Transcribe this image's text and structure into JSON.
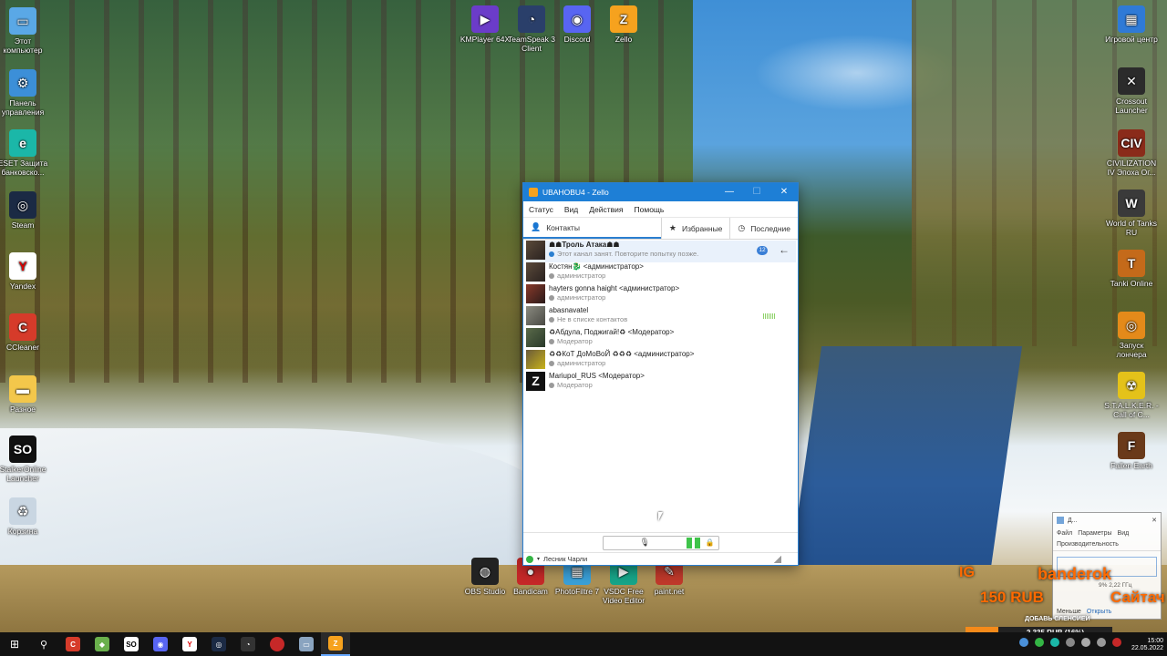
{
  "desktop_icons_left": [
    {
      "label": "Этот компьютер",
      "icon": "monitor-icon",
      "color": "#5aa8e6",
      "glyph": "▭"
    },
    {
      "label": "Панель управления",
      "icon": "control-panel-icon",
      "color": "#3c8fd8",
      "glyph": "⚙"
    },
    {
      "label": "ESET Защита банковско...",
      "icon": "eset-icon",
      "color": "#1bb7a8",
      "glyph": "e"
    },
    {
      "label": "Steam",
      "icon": "steam-icon",
      "color": "#1b2a44",
      "glyph": "◎"
    },
    {
      "label": "Yandex",
      "icon": "yandex-icon",
      "color": "#ffffff",
      "glyph": "Y"
    },
    {
      "label": "CCleaner",
      "icon": "ccleaner-icon",
      "color": "#d63b2a",
      "glyph": "C"
    },
    {
      "label": "Разное",
      "icon": "folder-icon",
      "color": "#f3c74b",
      "glyph": "▬"
    },
    {
      "label": "StalkerOnline Launcher",
      "icon": "stalkeronline-icon",
      "color": "#111111",
      "glyph": "SO"
    },
    {
      "label": "Корзина",
      "icon": "recycle-bin-icon",
      "color": "#c9d6e2",
      "glyph": "♻"
    }
  ],
  "desktop_icons_top": [
    {
      "label": "KMPlayer 64X",
      "icon": "kmplayer-icon",
      "color": "#6b3cc9",
      "glyph": "▶"
    },
    {
      "label": "TeamSpeak 3 Client",
      "icon": "teamspeak-icon",
      "color": "#2a3f6a",
      "glyph": "◔"
    },
    {
      "label": "Discord",
      "icon": "discord-icon",
      "color": "#5865f2",
      "glyph": "◉"
    },
    {
      "label": "Zello",
      "icon": "zello-icon",
      "color": "#f6a21e",
      "glyph": "Z"
    }
  ],
  "desktop_icons_right": [
    {
      "label": "Игровой центр",
      "icon": "game-center-icon",
      "color": "#2f7ad6",
      "glyph": "▦"
    },
    {
      "label": "Crossout Launcher",
      "icon": "crossout-icon",
      "color": "#2b2b2b",
      "glyph": "✕"
    },
    {
      "label": "CIVILIZATION IV Эпоха Ог...",
      "icon": "civilization-icon",
      "color": "#8a2b1a",
      "glyph": "CIV"
    },
    {
      "label": "World of Tanks RU",
      "icon": "world-of-tanks-icon",
      "color": "#3a3a3a",
      "glyph": "W"
    },
    {
      "label": "Tanki Online",
      "icon": "tanki-online-icon",
      "color": "#c46a1a",
      "glyph": "T"
    },
    {
      "label": "Запуск лончера",
      "icon": "launcher-icon",
      "color": "#e48a1a",
      "glyph": "◎"
    },
    {
      "label": "S.T.A.L.K.E.R. - Call of C...",
      "icon": "stalker-icon",
      "color": "#e4c21a",
      "glyph": "☢"
    },
    {
      "label": "Fallen Earth",
      "icon": "fallen-earth-icon",
      "color": "#6a3a1a",
      "glyph": "F"
    }
  ],
  "desktop_icons_bottom": [
    {
      "label": "OBS Studio",
      "icon": "obs-icon",
      "color": "#222222",
      "glyph": "◍"
    },
    {
      "label": "Bandicam",
      "icon": "bandicam-icon",
      "color": "#c62828",
      "glyph": "●"
    },
    {
      "label": "PhotoFiltre 7",
      "icon": "photofiltre-icon",
      "color": "#3aa0d8",
      "glyph": "▦"
    },
    {
      "label": "VSDC Free Video Editor",
      "icon": "vsdc-icon",
      "color": "#17a589",
      "glyph": "▶"
    },
    {
      "label": "paint.net",
      "icon": "paintnet-icon",
      "color": "#c0392b",
      "glyph": "✎"
    }
  ],
  "zello": {
    "title": "UBAHOBU4 - Zello",
    "menu": [
      "Статус",
      "Вид",
      "Действия",
      "Помощь"
    ],
    "tabs": {
      "contacts": "Контакты",
      "favorites": "Избранные",
      "recent": "Последние"
    },
    "contacts": [
      {
        "name": "☗☗Троль Атака☗☗",
        "status": "Этот канал занят. Повторите попытку позже.",
        "badge": "12",
        "bold": true
      },
      {
        "name": "Костян🐉 <администратор>",
        "status": "администратор"
      },
      {
        "name": "hayters gonna haight <администратор>",
        "status": "администратор"
      },
      {
        "name": "abasnavatel",
        "status": "Не в списке контактов"
      },
      {
        "name": "♻Абдула, Поджигай!♻ <Модератор>",
        "status": "Модератор"
      },
      {
        "name": "♻♻КоТ ДоМоВоЙ ♻♻♻ <администратор>",
        "status": "администратор"
      },
      {
        "name": "Mariupol_RUS <Модератор>",
        "status": "Модератор"
      }
    ],
    "status_user": "Лесник Чарли"
  },
  "task_manager": {
    "title": "Д...",
    "menu": [
      "Файл",
      "Параметры",
      "Вид"
    ],
    "tab": "Производительность",
    "meta": "9% 2,22 ГГц",
    "less": "Меньше",
    "open": "Открыть"
  },
  "overlay": {
    "left_text": "IG",
    "price": "150 RUB",
    "nick": "banderok",
    "site": "Сайтач",
    "add_text": "ДОБАВЬ СЛЕНСИЕЙ",
    "donation": "2 335 RUB (16%)"
  },
  "clock": {
    "time": "15:00",
    "date": "22.05.2022"
  }
}
